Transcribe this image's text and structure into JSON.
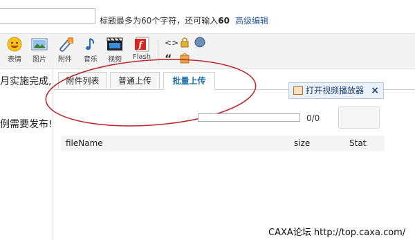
{
  "title_row": {
    "hint_prefix": "标题最多为60个字符，还可输入",
    "hint_count": "60",
    "advanced_link": "高级编辑"
  },
  "toolbar": {
    "items": [
      {
        "label": "表情",
        "icon": "smiley-icon"
      },
      {
        "label": "图片",
        "icon": "image-icon"
      },
      {
        "label": "附件",
        "icon": "attachment-icon"
      },
      {
        "label": "音乐",
        "icon": "music-icon"
      },
      {
        "label": "视频",
        "icon": "video-icon"
      },
      {
        "label": "Flash",
        "icon": "flash-icon"
      }
    ],
    "code_symbol": "<>",
    "quote_symbol": "“",
    "lock_icon": "lock-icon",
    "compass_icon": "compass-icon",
    "hide_icon": "hide-icon"
  },
  "editor": {
    "line1": "月实施完成,",
    "line2": "例需要发布!"
  },
  "tabs": [
    {
      "label": "附件列表",
      "active": false
    },
    {
      "label": "普通上传",
      "active": false
    },
    {
      "label": "批量上传",
      "active": true
    }
  ],
  "video_player": {
    "label": "打开视频播放器",
    "close": "×"
  },
  "upload": {
    "progress_text": "0/0",
    "progress_fraction": 0,
    "columns": [
      "fileName",
      "size",
      "Stat"
    ]
  },
  "watermark": "CAXA论坛 http://top.caxa.com/",
  "colors": {
    "link": "#2c5a9b",
    "active_tab": "#1e6ea8",
    "annotation_ellipse": "#c0282d"
  }
}
